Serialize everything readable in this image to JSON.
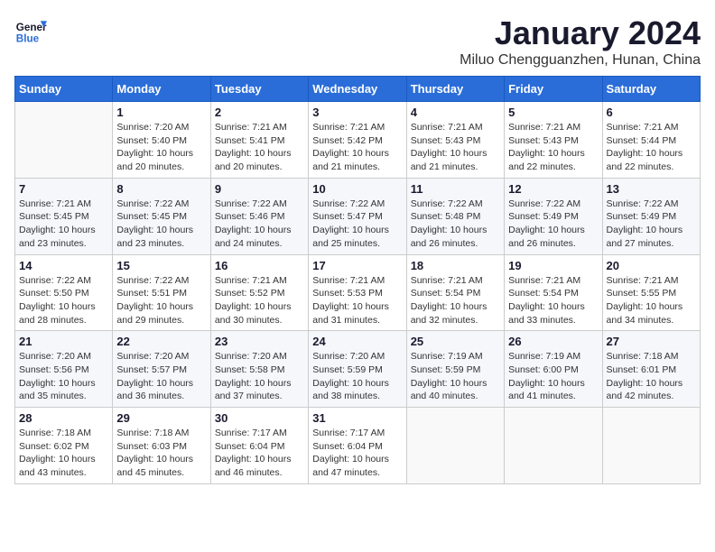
{
  "logo": {
    "line1": "General",
    "line2": "Blue"
  },
  "title": "January 2024",
  "location": "Miluo Chengguanzhen, Hunan, China",
  "weekdays": [
    "Sunday",
    "Monday",
    "Tuesday",
    "Wednesday",
    "Thursday",
    "Friday",
    "Saturday"
  ],
  "weeks": [
    [
      {
        "day": "",
        "info": ""
      },
      {
        "day": "1",
        "info": "Sunrise: 7:20 AM\nSunset: 5:40 PM\nDaylight: 10 hours\nand 20 minutes."
      },
      {
        "day": "2",
        "info": "Sunrise: 7:21 AM\nSunset: 5:41 PM\nDaylight: 10 hours\nand 20 minutes."
      },
      {
        "day": "3",
        "info": "Sunrise: 7:21 AM\nSunset: 5:42 PM\nDaylight: 10 hours\nand 21 minutes."
      },
      {
        "day": "4",
        "info": "Sunrise: 7:21 AM\nSunset: 5:43 PM\nDaylight: 10 hours\nand 21 minutes."
      },
      {
        "day": "5",
        "info": "Sunrise: 7:21 AM\nSunset: 5:43 PM\nDaylight: 10 hours\nand 22 minutes."
      },
      {
        "day": "6",
        "info": "Sunrise: 7:21 AM\nSunset: 5:44 PM\nDaylight: 10 hours\nand 22 minutes."
      }
    ],
    [
      {
        "day": "7",
        "info": "Sunrise: 7:21 AM\nSunset: 5:45 PM\nDaylight: 10 hours\nand 23 minutes."
      },
      {
        "day": "8",
        "info": "Sunrise: 7:22 AM\nSunset: 5:45 PM\nDaylight: 10 hours\nand 23 minutes."
      },
      {
        "day": "9",
        "info": "Sunrise: 7:22 AM\nSunset: 5:46 PM\nDaylight: 10 hours\nand 24 minutes."
      },
      {
        "day": "10",
        "info": "Sunrise: 7:22 AM\nSunset: 5:47 PM\nDaylight: 10 hours\nand 25 minutes."
      },
      {
        "day": "11",
        "info": "Sunrise: 7:22 AM\nSunset: 5:48 PM\nDaylight: 10 hours\nand 26 minutes."
      },
      {
        "day": "12",
        "info": "Sunrise: 7:22 AM\nSunset: 5:49 PM\nDaylight: 10 hours\nand 26 minutes."
      },
      {
        "day": "13",
        "info": "Sunrise: 7:22 AM\nSunset: 5:49 PM\nDaylight: 10 hours\nand 27 minutes."
      }
    ],
    [
      {
        "day": "14",
        "info": "Sunrise: 7:22 AM\nSunset: 5:50 PM\nDaylight: 10 hours\nand 28 minutes."
      },
      {
        "day": "15",
        "info": "Sunrise: 7:22 AM\nSunset: 5:51 PM\nDaylight: 10 hours\nand 29 minutes."
      },
      {
        "day": "16",
        "info": "Sunrise: 7:21 AM\nSunset: 5:52 PM\nDaylight: 10 hours\nand 30 minutes."
      },
      {
        "day": "17",
        "info": "Sunrise: 7:21 AM\nSunset: 5:53 PM\nDaylight: 10 hours\nand 31 minutes."
      },
      {
        "day": "18",
        "info": "Sunrise: 7:21 AM\nSunset: 5:54 PM\nDaylight: 10 hours\nand 32 minutes."
      },
      {
        "day": "19",
        "info": "Sunrise: 7:21 AM\nSunset: 5:54 PM\nDaylight: 10 hours\nand 33 minutes."
      },
      {
        "day": "20",
        "info": "Sunrise: 7:21 AM\nSunset: 5:55 PM\nDaylight: 10 hours\nand 34 minutes."
      }
    ],
    [
      {
        "day": "21",
        "info": "Sunrise: 7:20 AM\nSunset: 5:56 PM\nDaylight: 10 hours\nand 35 minutes."
      },
      {
        "day": "22",
        "info": "Sunrise: 7:20 AM\nSunset: 5:57 PM\nDaylight: 10 hours\nand 36 minutes."
      },
      {
        "day": "23",
        "info": "Sunrise: 7:20 AM\nSunset: 5:58 PM\nDaylight: 10 hours\nand 37 minutes."
      },
      {
        "day": "24",
        "info": "Sunrise: 7:20 AM\nSunset: 5:59 PM\nDaylight: 10 hours\nand 38 minutes."
      },
      {
        "day": "25",
        "info": "Sunrise: 7:19 AM\nSunset: 5:59 PM\nDaylight: 10 hours\nand 40 minutes."
      },
      {
        "day": "26",
        "info": "Sunrise: 7:19 AM\nSunset: 6:00 PM\nDaylight: 10 hours\nand 41 minutes."
      },
      {
        "day": "27",
        "info": "Sunrise: 7:18 AM\nSunset: 6:01 PM\nDaylight: 10 hours\nand 42 minutes."
      }
    ],
    [
      {
        "day": "28",
        "info": "Sunrise: 7:18 AM\nSunset: 6:02 PM\nDaylight: 10 hours\nand 43 minutes."
      },
      {
        "day": "29",
        "info": "Sunrise: 7:18 AM\nSunset: 6:03 PM\nDaylight: 10 hours\nand 45 minutes."
      },
      {
        "day": "30",
        "info": "Sunrise: 7:17 AM\nSunset: 6:04 PM\nDaylight: 10 hours\nand 46 minutes."
      },
      {
        "day": "31",
        "info": "Sunrise: 7:17 AM\nSunset: 6:04 PM\nDaylight: 10 hours\nand 47 minutes."
      },
      {
        "day": "",
        "info": ""
      },
      {
        "day": "",
        "info": ""
      },
      {
        "day": "",
        "info": ""
      }
    ]
  ]
}
